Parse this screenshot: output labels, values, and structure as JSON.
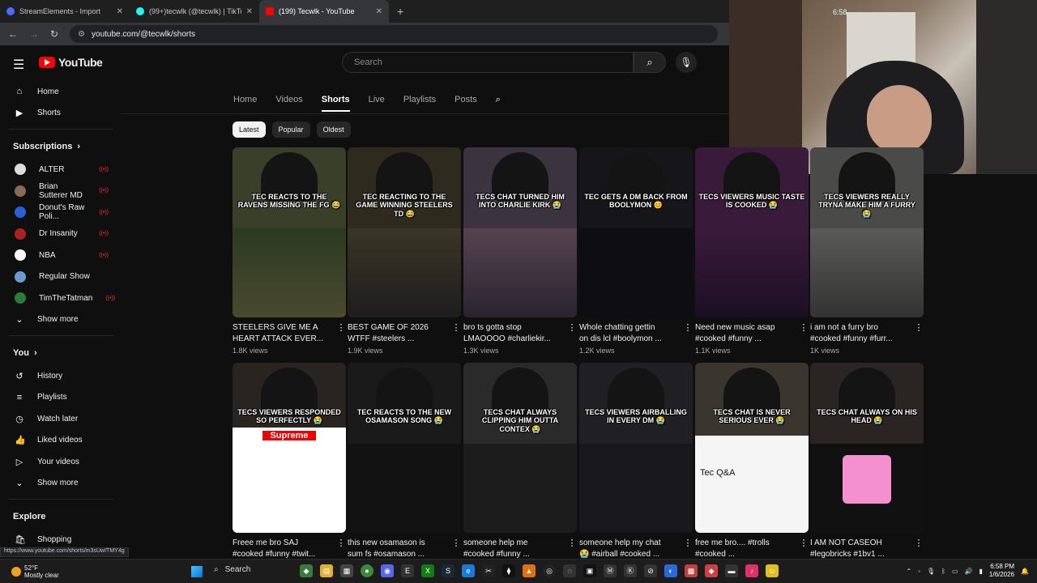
{
  "browser": {
    "tabs": [
      {
        "title": "StreamElements - Import",
        "color": "#4b6bff"
      },
      {
        "title": "(99+)tecwlk (@tecwlk) | TikTok",
        "color": "#111111"
      },
      {
        "title": "(199) Tecwlk - YouTube",
        "color": "#ff0000"
      }
    ],
    "url": "youtube.com/@tecwlk/shorts",
    "status_url": "https://www.youtube.com/shorts/m3sUwITMY4g"
  },
  "webcam": {
    "clock": "6:58"
  },
  "youtube": {
    "logo": "YouTube",
    "search_placeholder": "Search",
    "sidebar": {
      "main": [
        {
          "label": "Home",
          "icon": "home-icon"
        },
        {
          "label": "Shorts",
          "icon": "shorts-icon"
        }
      ],
      "subscriptions_title": "Subscriptions",
      "subscriptions": [
        {
          "label": "ALTER",
          "color": "#dddddd"
        },
        {
          "label": "Brian Sutterer MD",
          "color": "#8a6a55"
        },
        {
          "label": "Donut's Raw Poli...",
          "color": "#2c5fd6"
        },
        {
          "label": "Dr Insanity",
          "color": "#aa2222"
        },
        {
          "label": "NBA",
          "color": "#ffffff"
        },
        {
          "label": "Regular Show",
          "color": "#6a9ad0"
        },
        {
          "label": "TimTheTatman",
          "color": "#2d7a3a"
        }
      ],
      "show_more": "Show more",
      "you_title": "You",
      "you_items": [
        {
          "label": "History",
          "icon": "history-icon"
        },
        {
          "label": "Playlists",
          "icon": "playlists-icon"
        },
        {
          "label": "Watch later",
          "icon": "watch-later-icon"
        },
        {
          "label": "Liked videos",
          "icon": "liked-videos-icon"
        },
        {
          "label": "Your videos",
          "icon": "your-videos-icon"
        }
      ],
      "show_more_2": "Show more",
      "explore_title": "Explore",
      "explore_items": [
        {
          "label": "Shopping",
          "icon": "shopping-icon"
        }
      ]
    },
    "channel_tabs": [
      "Home",
      "Videos",
      "Shorts",
      "Live",
      "Playlists",
      "Posts"
    ],
    "selected_tab": "Shorts",
    "chips": [
      "Latest",
      "Popular",
      "Oldest"
    ],
    "shorts": [
      {
        "caption": "TEC REACTS TO THE RAVENS MISSING THE FG 😂",
        "title1": "STEELERS GIVE ME A",
        "title2": "HEART ATTACK EVER...",
        "views": "1.8K views",
        "bg": "#3a3f2a"
      },
      {
        "caption": "TEC REACTING TO THE GAME WINNING STEELERS TD 😂",
        "title1": "BEST GAME OF 2026",
        "title2": "WTFF #steelers ...",
        "views": "1.9K views",
        "bg": "#2e2a1e"
      },
      {
        "caption": "TECS CHAT TURNED HIM INTO CHARLIE KIRK 😭",
        "title1": "bro ts gotta stop",
        "title2": "LMAOOOO #charliekir...",
        "views": "1.3K views",
        "bg": "#3b3440"
      },
      {
        "caption": "TEC GETS A DM BACK FROM BOOLYMON 😊",
        "title1": "Whole chatting gettin",
        "title2": "on dis lcl #boolymon ...",
        "views": "1.2K views",
        "bg": "#16161a"
      },
      {
        "caption": "TECS VIEWERS MUSIC TASTE IS COOKED 😭",
        "title1": "Need new music asap",
        "title2": "#cooked #funny ...",
        "views": "1.1K views",
        "bg": "#3a1a3a"
      },
      {
        "caption": "TECS VIEWERS REALLY TRYNA MAKE HIM A FURRY 😭",
        "title1": "i am not a furry bro",
        "title2": "#cooked #funny #furr...",
        "views": "1K views",
        "bg": "#4a4a48"
      },
      {
        "caption": "TECS VIEWERS RESPONDED SO PERFECTLY 😭",
        "title1": "Freee me bro SAJ",
        "title2": "#cooked #funny #twit...",
        "views": "",
        "bg": "#ffffff"
      },
      {
        "caption": "TEC REACTS TO THE NEW OSAMASON SONG 😭",
        "title1": "this new osamason is",
        "title2": "sum fs #osamason ...",
        "views": "",
        "bg": "#1a1a1a"
      },
      {
        "caption": "TECS CHAT ALWAYS CLIPPING HIM OUTTA CONTEX 😭",
        "title1": "someone help me",
        "title2": "#cooked #funny ...",
        "views": "",
        "bg": "#2a2a2a"
      },
      {
        "caption": "TECS VIEWERS AIRBALLING IN EVERY DM 😭",
        "title1": "someone help my chat",
        "title2": "😭 #airball #cooked ...",
        "views": "",
        "bg": "#202024"
      },
      {
        "caption": "TECS CHAT IS NEVER SERIOUS EVER 😭",
        "title1": "free me bro.... #trolls",
        "title2": "#cooked ...",
        "views": "",
        "bg": "#f5f5f5"
      },
      {
        "caption": "TECS CHAT ALWAYS ON HIS HEAD 😭",
        "title1": "I AM NOT CASEOH",
        "title2": "#legobricks #1bv1 ...",
        "views": "",
        "bg": "#111111"
      }
    ],
    "card_texts": {
      "supreme": "Supreme",
      "tec_qa": "Tec Q&A"
    }
  },
  "taskbar": {
    "temp": "52°F",
    "weather": "Mostly clear",
    "search": "Search",
    "time": "6:58 PM",
    "date": "1/6/2026"
  }
}
